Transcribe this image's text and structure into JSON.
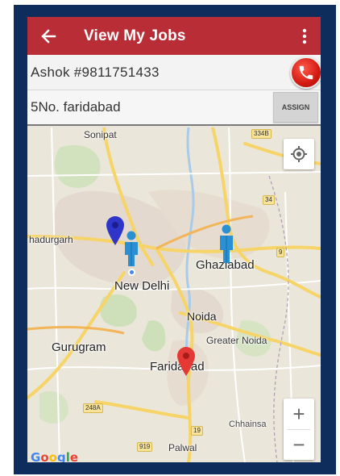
{
  "toolbar": {
    "title": "View My Jobs",
    "back_icon": "arrow-left-icon",
    "menu_icon": "more-vert-icon",
    "color": "#b92e36"
  },
  "job": {
    "contact": "Ashok  #9811751433",
    "address": "5No. faridabad",
    "assign_label": "ASSIGN"
  },
  "map": {
    "places": {
      "sonipat": "Sonipat",
      "bahadurgarh": "hadurgarh",
      "new_delhi": "New Delhi",
      "ghaziabad": "Ghaziabad",
      "noida": "Noida",
      "greater_noida": "Greater Noida",
      "gurugram": "Gurugram",
      "faridabad": "Faridabad",
      "chhainsa": "Chhainsa",
      "palwal": "Palwal"
    },
    "shields": {
      "s334b": "334B",
      "s34": "34",
      "s9": "9",
      "s248a": "248A",
      "s919": "919",
      "s19": "19"
    },
    "zoom_in": "+",
    "zoom_out": "−",
    "google_logo": "Google"
  }
}
